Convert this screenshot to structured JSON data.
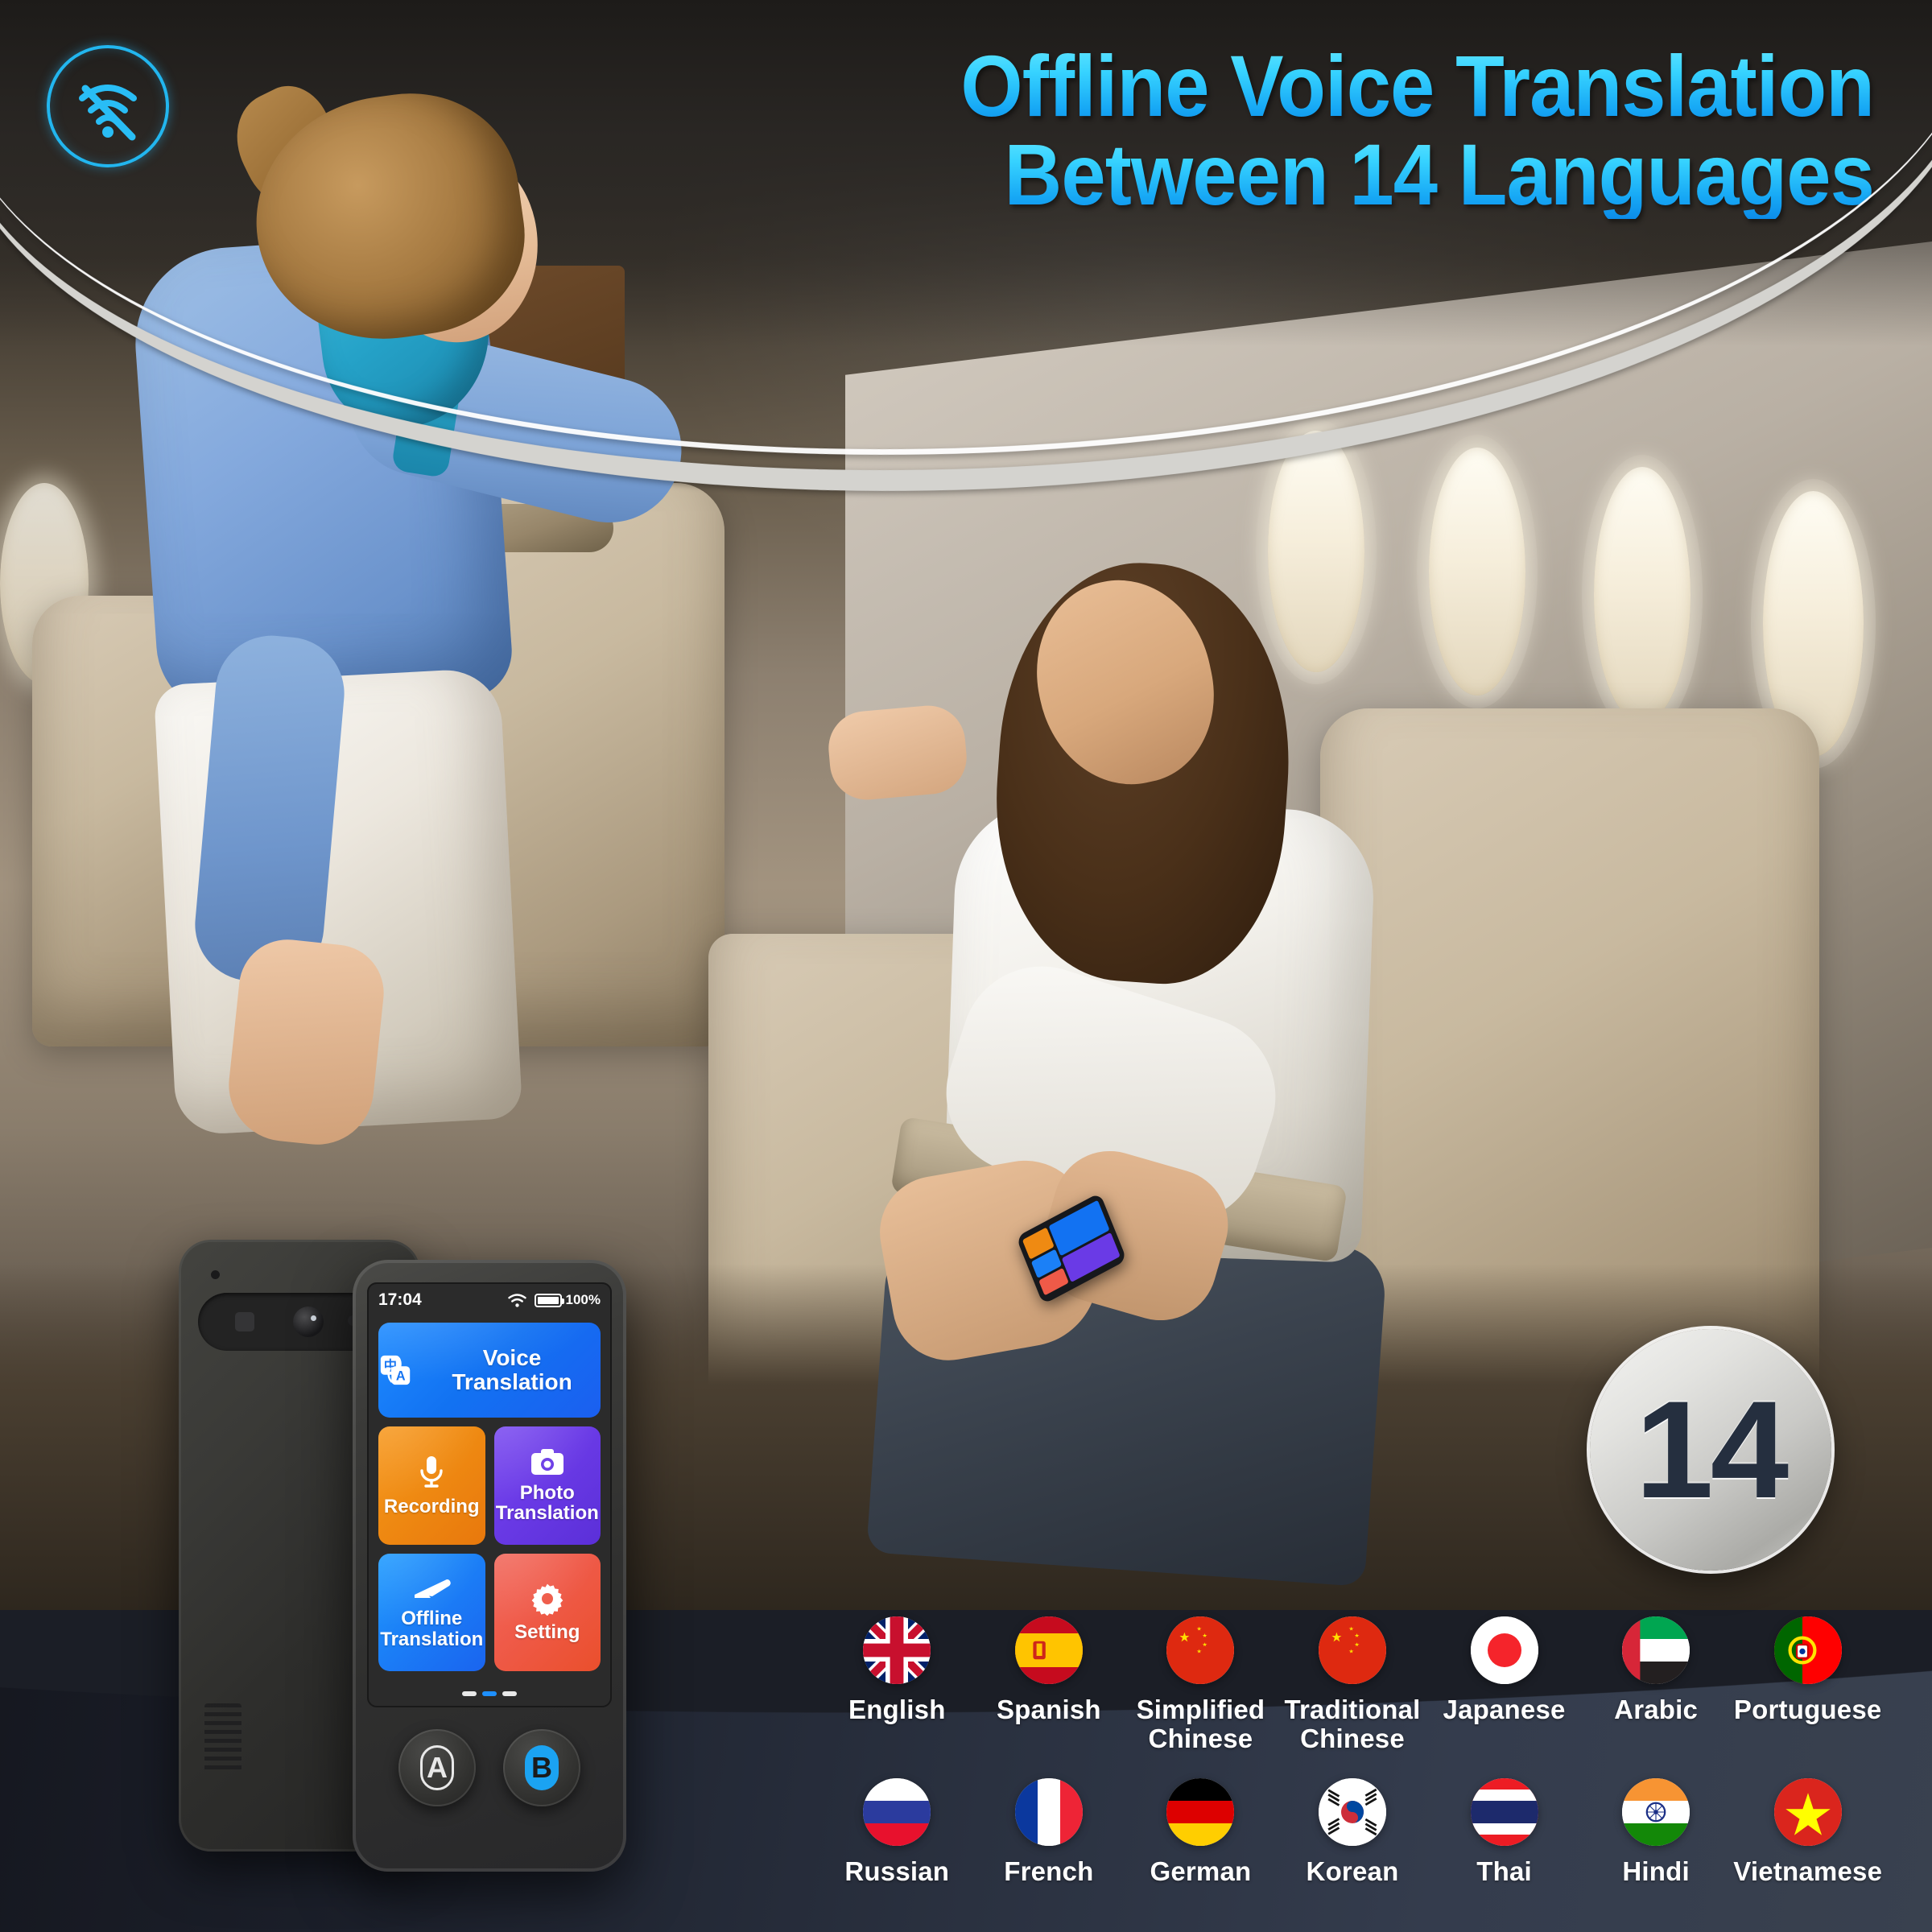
{
  "headline": {
    "line1": "Offline Voice Translation",
    "line2": "Between 14 Languages",
    "accent_color": "#36d2ff"
  },
  "wifi_badge": {
    "icon": "wifi-off-icon",
    "color": "#22b6ef"
  },
  "count_badge": {
    "value": "14"
  },
  "device": {
    "status_bar": {
      "time": "17:04",
      "wifi_icon": "wifi-icon",
      "battery_icon": "battery-full-icon",
      "battery_percent": "100%"
    },
    "tiles": [
      {
        "label": "Voice Translation",
        "icon": "translate-icon",
        "color": "#1272f2"
      },
      {
        "label": "Recording",
        "icon": "microphone-icon",
        "color": "#ef8a12"
      },
      {
        "label": "Photo\nTranslation",
        "icon": "camera-icon",
        "color": "#6a3ae6"
      },
      {
        "label": "Offline\nTranslation",
        "icon": "airplane-icon",
        "color": "#1b80f7"
      },
      {
        "label": "Setting",
        "icon": "gear-icon",
        "color": "#ef5a48"
      }
    ],
    "page_dots": {
      "total": 3,
      "active_index": 1
    },
    "buttons": [
      {
        "label": "A",
        "style": "outline"
      },
      {
        "label": "B",
        "style": "filled"
      }
    ],
    "translate_icon_chars": {
      "source": "中",
      "target": "A"
    }
  },
  "languages": [
    {
      "name": "English",
      "flag": "flag-uk"
    },
    {
      "name": "Spanish",
      "flag": "flag-spain"
    },
    {
      "name": "Simplified\nChinese",
      "flag": "flag-china"
    },
    {
      "name": "Traditional\nChinese",
      "flag": "flag-china"
    },
    {
      "name": "Japanese",
      "flag": "flag-japan"
    },
    {
      "name": "Arabic",
      "flag": "flag-uae"
    },
    {
      "name": "Portuguese",
      "flag": "flag-portugal"
    },
    {
      "name": "Russian",
      "flag": "flag-russia"
    },
    {
      "name": "French",
      "flag": "flag-france"
    },
    {
      "name": "German",
      "flag": "flag-germany"
    },
    {
      "name": "Korean",
      "flag": "flag-korea"
    },
    {
      "name": "Thai",
      "flag": "flag-thailand"
    },
    {
      "name": "Hindi",
      "flag": "flag-india"
    },
    {
      "name": "Vietnamese",
      "flag": "flag-vietnam"
    }
  ]
}
